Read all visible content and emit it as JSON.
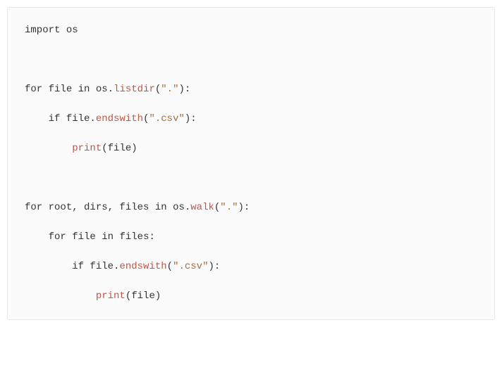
{
  "code": {
    "line1": {
      "kw1": "import",
      "txt1": " os"
    },
    "line2": "",
    "line3": {
      "kw1": "for",
      "txt1": " file ",
      "kw2": "in",
      "txt2": " os.",
      "fn1": "listdir",
      "txt3": "(",
      "str1": "\".\"",
      "txt4": "):"
    },
    "line4": {
      "indent": "    ",
      "kw1": "if",
      "txt1": " file.",
      "fn1": "endswith",
      "txt2": "(",
      "str1": "\".csv\"",
      "txt3": "):"
    },
    "line5": {
      "indent": "        ",
      "fn1": "print",
      "txt1": "(file)"
    },
    "line6": "",
    "line7": {
      "kw1": "for",
      "txt1": " root, dirs, files ",
      "kw2": "in",
      "txt2": " os.",
      "fn1": "walk",
      "txt3": "(",
      "str1": "\".\"",
      "txt4": "):"
    },
    "line8": {
      "indent": "    ",
      "kw1": "for",
      "txt1": " file ",
      "kw2": "in",
      "txt2": " files:"
    },
    "line9": {
      "indent": "        ",
      "kw1": "if",
      "txt1": " file.",
      "fn1": "endswith",
      "txt2": "(",
      "str1": "\".csv\"",
      "txt3": "):"
    },
    "line10": {
      "indent": "            ",
      "fn1": "print",
      "txt1": "(file)"
    }
  }
}
